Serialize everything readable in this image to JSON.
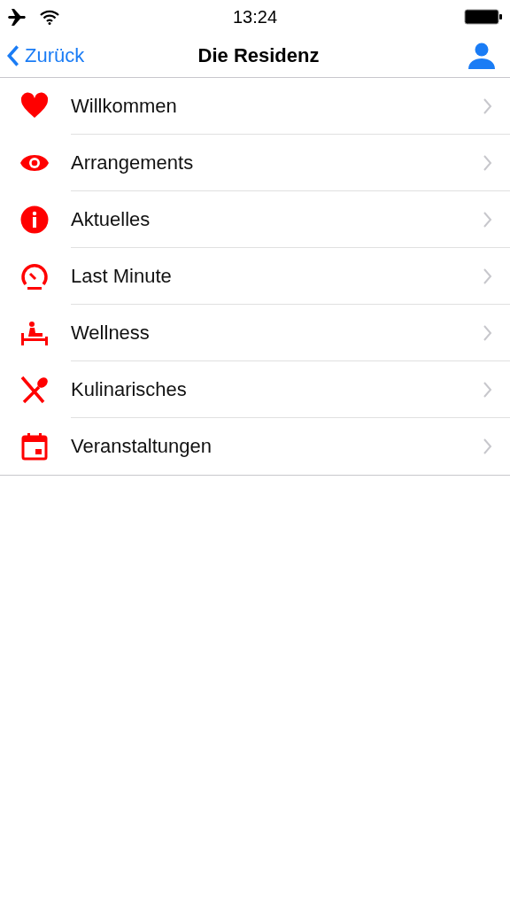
{
  "status_bar": {
    "time": "13:24"
  },
  "nav": {
    "back": "Zurück",
    "title": "Die Residenz"
  },
  "items": [
    {
      "label": "Willkommen",
      "kind": "heart"
    },
    {
      "label": "Arrangements",
      "kind": "eye"
    },
    {
      "label": "Aktuelles",
      "kind": "info"
    },
    {
      "label": "Last Minute",
      "kind": "gauge"
    },
    {
      "label": "Wellness",
      "kind": "spa"
    },
    {
      "label": "Kulinarisches",
      "kind": "food"
    },
    {
      "label": "Veranstaltungen",
      "kind": "calendar"
    }
  ]
}
